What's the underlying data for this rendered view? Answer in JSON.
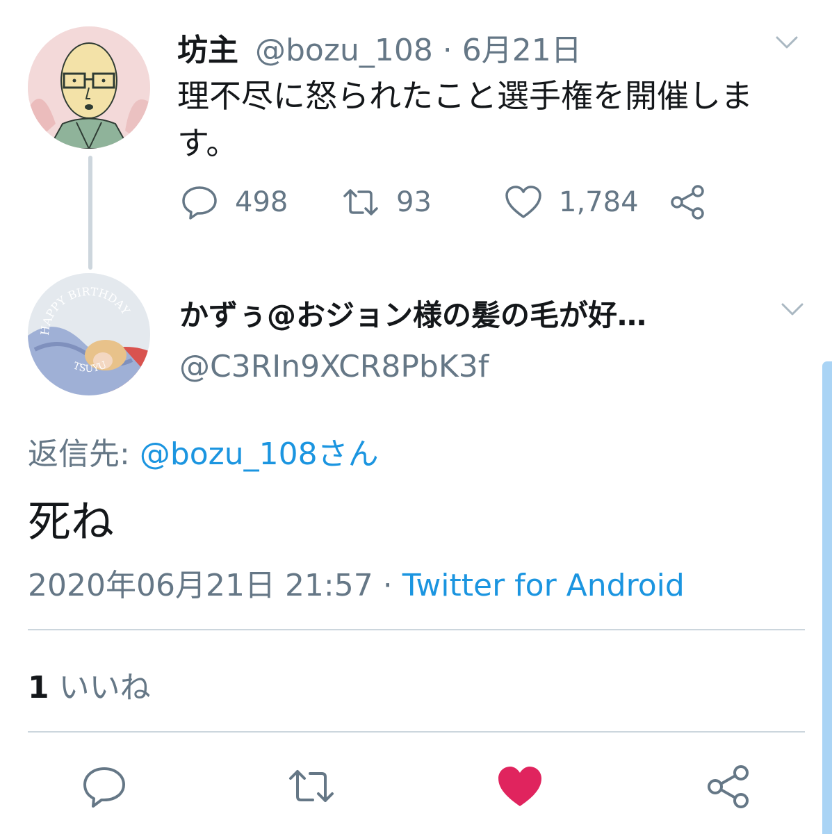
{
  "parent_tweet": {
    "display_name": "坊主",
    "handle_date": "@bozu_108 · 6月21日",
    "text": "理不尽に怒られたこと選手権を開催します。",
    "reply_count": "498",
    "retweet_count": "93",
    "like_count": "1,784"
  },
  "reply_tweet": {
    "display_name": "かずぅ@おジョン様の髪の毛が好…",
    "handle": "@C3RIn9XCR8PbK3f",
    "reply_to_label": "返信先: ",
    "reply_to_mention": "@bozu_108さん",
    "text": "死ね",
    "timestamp": "2020年06月21日 21:57",
    "separator": " · ",
    "source": "Twitter for Android",
    "likes_count": "1",
    "likes_label": " いいね",
    "avatar_text_top": "HAPPY BIRTHDAY",
    "avatar_text_bottom": "TSUYU"
  },
  "icons": {
    "reply": "comment-bubble-icon",
    "retweet": "retweet-arrows-icon",
    "like": "heart-icon",
    "share": "share-nodes-icon",
    "menu": "chevron-down-icon"
  },
  "colors": {
    "accent_blue": "#1b95e0",
    "liked_red": "#e0245e",
    "secondary_text": "#657786"
  }
}
